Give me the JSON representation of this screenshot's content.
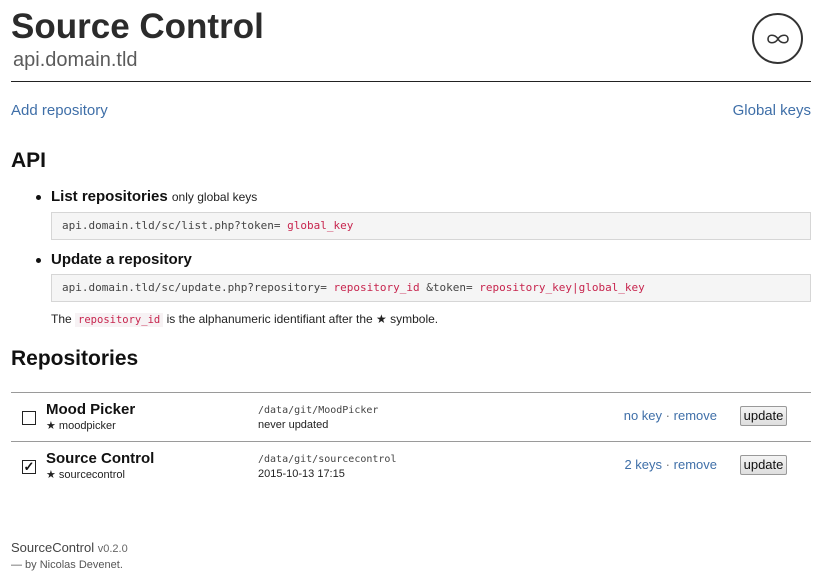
{
  "header": {
    "title": "Source Control",
    "subtitle": "api.domain.tld",
    "logo_icon": "infinity-icon"
  },
  "nav": {
    "add_repository": "Add repository",
    "global_keys": "Global keys"
  },
  "api": {
    "heading": "API",
    "list": {
      "title": "List repositories",
      "note": "only global keys",
      "url_prefix": "api.domain.tld/sc/list.php?token=",
      "var_token": "global_key"
    },
    "update": {
      "title": "Update a repository",
      "url_prefix": "api.domain.tld/sc/update.php?repository=",
      "var_repository": "repository_id",
      "url_mid": "&token=",
      "var_token": "repository_key|global_key"
    },
    "explanation": {
      "before": "The",
      "code": "repository_id",
      "after": "is the alphanumeric identifiant after the ★ symbole."
    }
  },
  "repositories": {
    "heading": "Repositories",
    "items": [
      {
        "name": "Mood Picker",
        "id": "★ moodpicker",
        "path": "/data/git/MoodPicker",
        "updated": "never updated",
        "checked": false,
        "keys_label": "no key",
        "separator": "·",
        "remove_label": "remove",
        "update_label": "update"
      },
      {
        "name": "Source Control",
        "id": "★ sourcecontrol",
        "path": "/data/git/sourcecontrol",
        "updated": "2015-10-13 17:15",
        "checked": true,
        "keys_label": "2 keys",
        "separator": "·",
        "remove_label": "remove",
        "update_label": "update"
      }
    ]
  },
  "footer": {
    "app_name": "SourceControl",
    "version": "v0.2.0",
    "author": "— by Nicolas Devenet."
  },
  "colors": {
    "link": "#3f6fa8",
    "code_var": "#c7254e"
  }
}
